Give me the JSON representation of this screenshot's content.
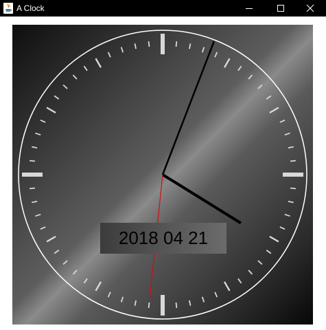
{
  "window": {
    "title": "A Clock",
    "controls": {
      "minimize_icon": "minimize-icon",
      "maximize_icon": "maximize-icon",
      "close_icon": "close-icon"
    }
  },
  "clock": {
    "date": "2018 04 21",
    "time": {
      "hour": 4,
      "minute": 3,
      "second": 31
    },
    "colors": {
      "ring": "#ffffff",
      "ticks": "#d8d8d8",
      "hour_hand": "#000000",
      "minute_hand": "#000000",
      "second_hand": "#cc1111"
    }
  }
}
